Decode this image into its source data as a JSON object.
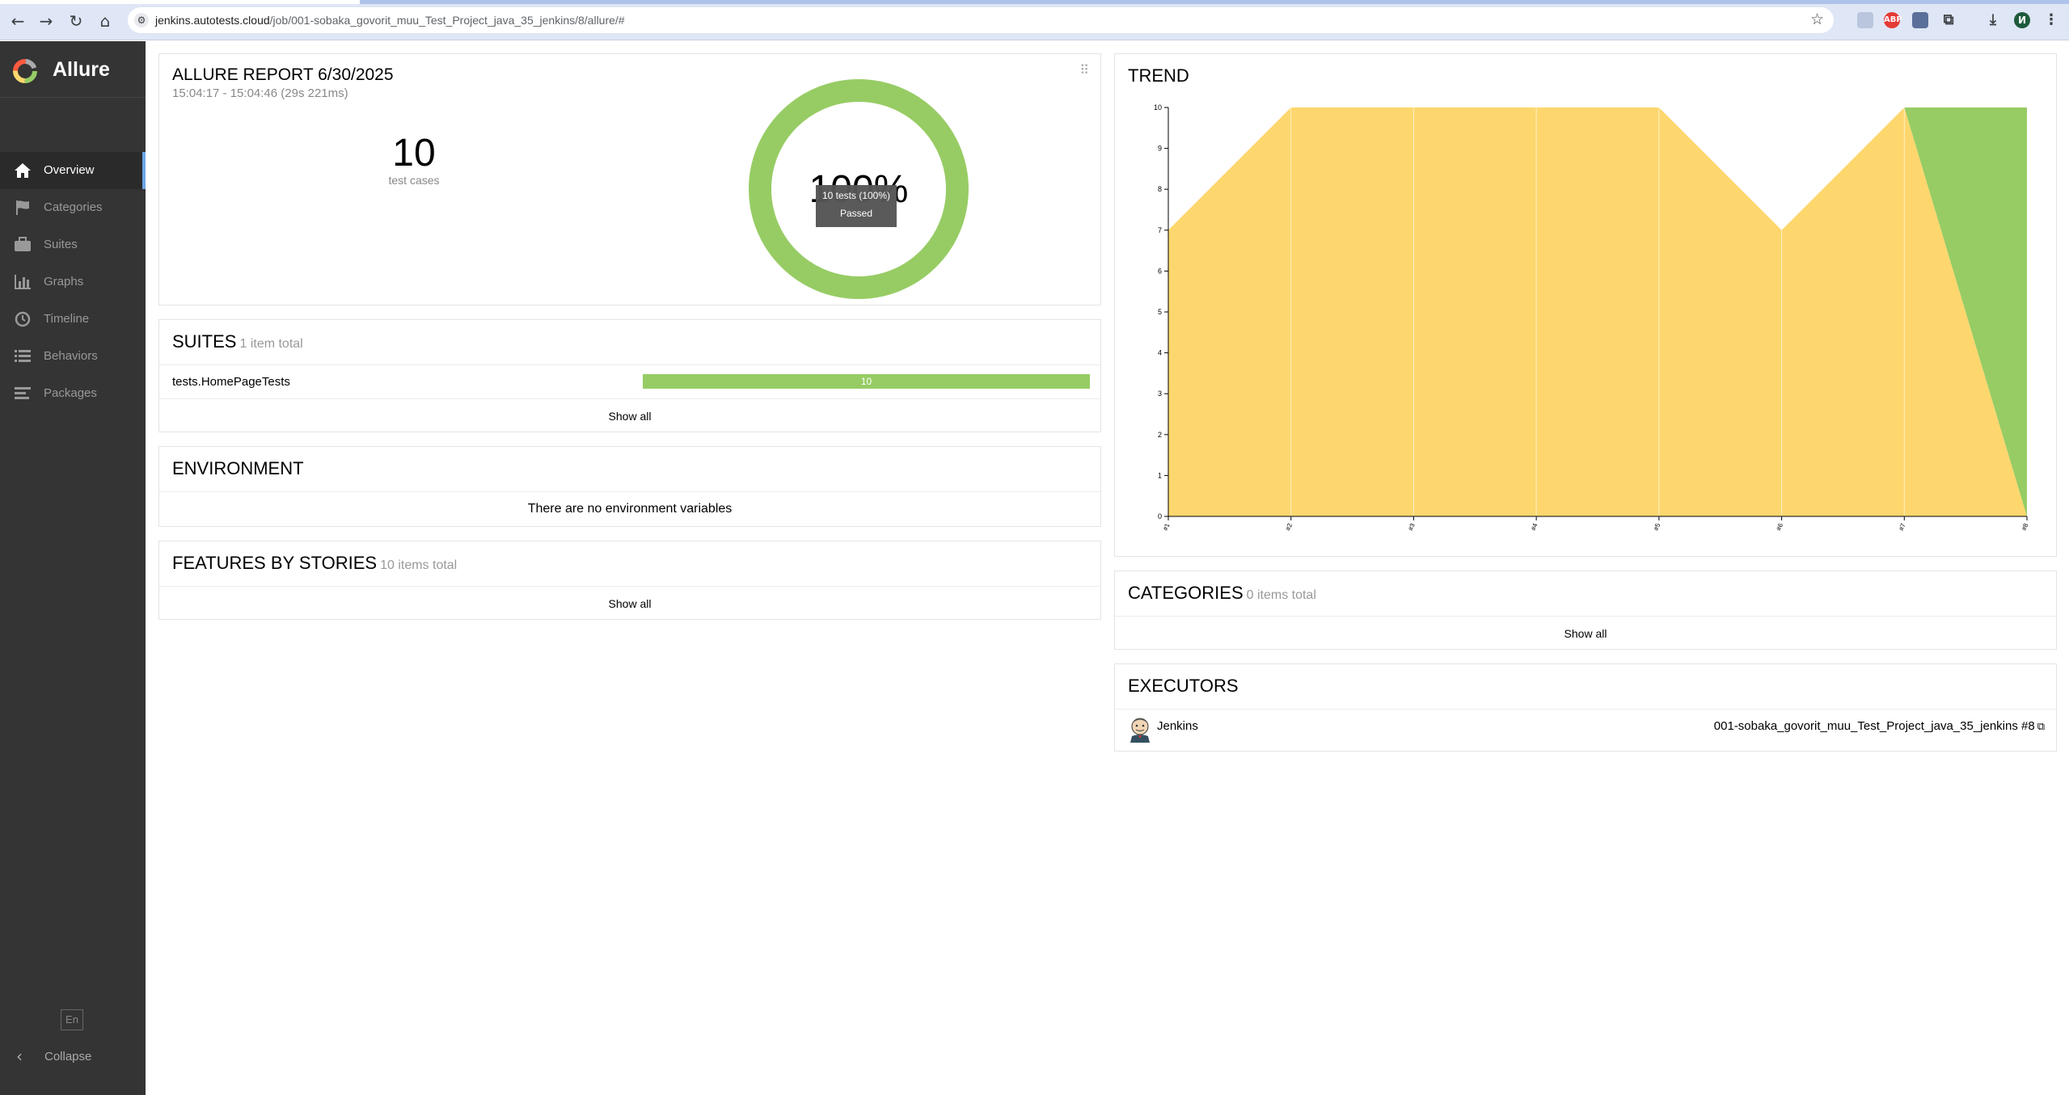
{
  "browser": {
    "url_host": "jenkins.autotests.cloud",
    "url_path": "/job/001-sobaka_govorit_muu_Test_Project_java_35_jenkins/8/allure/#",
    "profile_initial": "И",
    "abp_label": "ABP"
  },
  "sidebar": {
    "brand": "Allure",
    "items": [
      {
        "label": "Overview",
        "icon": "home-icon",
        "active": true
      },
      {
        "label": "Categories",
        "icon": "flag-icon",
        "active": false
      },
      {
        "label": "Suites",
        "icon": "briefcase-icon",
        "active": false
      },
      {
        "label": "Graphs",
        "icon": "bar-chart-icon",
        "active": false
      },
      {
        "label": "Timeline",
        "icon": "clock-icon",
        "active": false
      },
      {
        "label": "Behaviors",
        "icon": "list-icon",
        "active": false
      },
      {
        "label": "Packages",
        "icon": "align-left-icon",
        "active": false
      }
    ],
    "language": "En",
    "collapse_label": "Collapse"
  },
  "summary": {
    "title": "ALLURE REPORT 6/30/2025",
    "time_range": "15:04:17 - 15:04:46 (29s 221ms)",
    "test_count": "10",
    "test_caption": "test cases",
    "pass_percent": "100%",
    "tooltip_line1": "10 tests (100%)",
    "tooltip_line2": "Passed",
    "passed_fraction": 1.0,
    "passed_color": "#97cc64"
  },
  "suites": {
    "title": "SUITES",
    "count": "1 item total",
    "rows": [
      {
        "name": "tests.HomePageTests",
        "passed": "10"
      }
    ],
    "show_all": "Show all"
  },
  "environment": {
    "title": "ENVIRONMENT",
    "message": "There are no environment variables"
  },
  "features": {
    "title": "FEATURES BY STORIES",
    "count": "10 items total",
    "show_all": "Show all"
  },
  "trend": {
    "title": "TREND"
  },
  "chart_data": {
    "type": "area",
    "x": [
      "#1",
      "#2",
      "#3",
      "#4",
      "#5",
      "#6",
      "#7",
      "#8"
    ],
    "series": [
      {
        "name": "",
        "color": "#fdd76e",
        "values": [
          7,
          10,
          10,
          10,
          10,
          7,
          10,
          0
        ]
      },
      {
        "name": "",
        "color": "#97cc64",
        "values": [
          0,
          0,
          0,
          0,
          0,
          0,
          0,
          10
        ]
      }
    ],
    "ylim": [
      0,
      10
    ],
    "yticks": [
      0,
      1,
      2,
      3,
      4,
      5,
      6,
      7,
      8,
      9,
      10
    ]
  },
  "categories": {
    "title": "CATEGORIES",
    "count": "0 items total",
    "show_all": "Show all"
  },
  "executors": {
    "title": "EXECUTORS",
    "name": "Jenkins",
    "build": "001-sobaka_govorit_muu_Test_Project_java_35_jenkins #8"
  }
}
